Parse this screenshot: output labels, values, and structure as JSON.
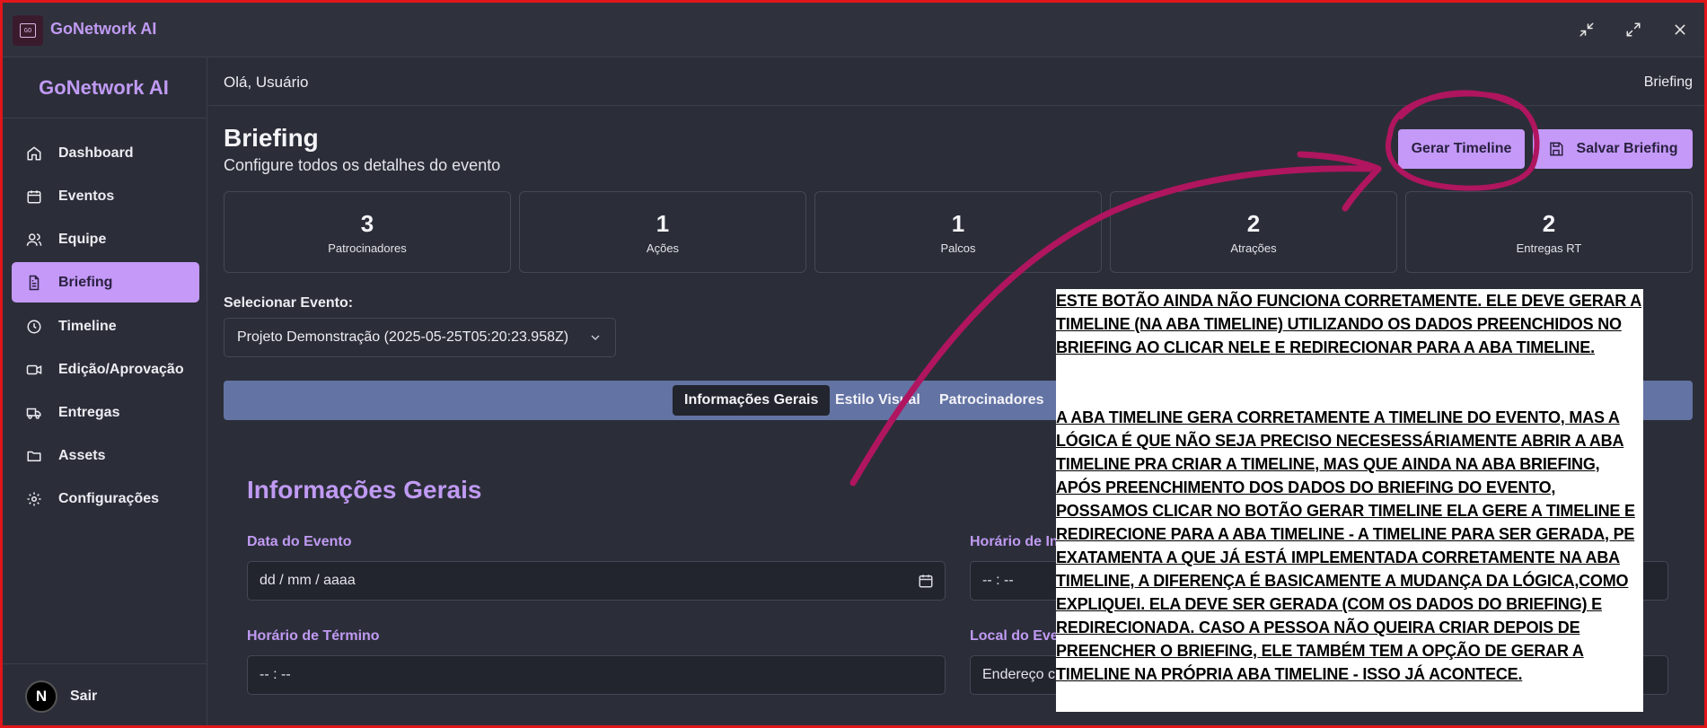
{
  "window": {
    "title": "GoNetwork AI",
    "logo_text": "GO"
  },
  "sidebar": {
    "brand": "GoNetwork AI",
    "items": [
      {
        "label": "Dashboard",
        "icon": "home-icon"
      },
      {
        "label": "Eventos",
        "icon": "calendar-icon"
      },
      {
        "label": "Equipe",
        "icon": "users-icon"
      },
      {
        "label": "Briefing",
        "icon": "file-text-icon",
        "active": true
      },
      {
        "label": "Timeline",
        "icon": "clock-icon"
      },
      {
        "label": "Edição/Aprovação",
        "icon": "video-icon"
      },
      {
        "label": "Entregas",
        "icon": "truck-icon"
      },
      {
        "label": "Assets",
        "icon": "folder-icon"
      },
      {
        "label": "Configurações",
        "icon": "gear-icon"
      }
    ],
    "avatar_letter": "N",
    "logout_label": "Sair"
  },
  "header": {
    "greeting": "Olá, Usuário",
    "breadcrumb": "Briefing"
  },
  "page": {
    "title": "Briefing",
    "subtitle": "Configure todos os detalhes do evento",
    "generate_button": "Gerar Timeline",
    "save_button": "Salvar Briefing"
  },
  "stats": [
    {
      "value": "3",
      "label": "Patrocinadores"
    },
    {
      "value": "1",
      "label": "Ações"
    },
    {
      "value": "1",
      "label": "Palcos"
    },
    {
      "value": "2",
      "label": "Atrações"
    },
    {
      "value": "2",
      "label": "Entregas RT"
    }
  ],
  "event_select": {
    "label": "Selecionar Evento:",
    "value": "Projeto Demonstração (2025-05-25T05:20:23.958Z)"
  },
  "tabs": [
    {
      "label": "Informações Gerais",
      "active": true
    },
    {
      "label": "Estilo Visual"
    },
    {
      "label": "Patrocinadores"
    }
  ],
  "section": {
    "title": "Informações Gerais",
    "event_date_label": "Data do Evento",
    "event_date_placeholder": "dd / mm / aaaa",
    "start_time_label": "Horário de In",
    "start_time_placeholder": "-- : --",
    "end_time_label": "Horário de Término",
    "end_time_placeholder": "-- : --",
    "location_label": "Local do Eve",
    "location_placeholder": "Endereço c"
  },
  "annotation": {
    "paragraph_1": "ESTE BOTÃO AINDA NÃO FUNCIONA CORRETAMENTE. ELE DEVE GERAR A TIMELINE (NA ABA TIMELINE) UTILIZANDO OS DADOS PREENCHIDOS NO BRIEFING AO CLICAR NELE E REDIRECIONAR PARA A ABA TIMELINE.",
    "paragraph_2": "A ABA TIMELINE GERA CORRETAMENTE A TIMELINE DO EVENTO, MAS A LÓGICA É QUE NÃO SEJA PRECISO NECESESSÁRIAMENTE ABRIR A ABA TIMELINE PRA CRIAR A TIMELINE, MAS QUE AINDA NA ABA BRIEFING, APÓS PREENCHIMENTO DOS DADOS DO BRIEFING DO EVENTO, POSSAMOS CLICAR NO BOTÃO GERAR TIMELINE ELA GERE A TIMELINE E REDIRECIONE PARA A ABA TIMELINE - A TIMELINE PARA SER GERADA, PE EXATAMENTA A QUE JÁ ESTÁ IMPLEMENTADA CORRETAMENTE NA ABA TIMELINE, A DIFERENÇA É BASICAMENTE A MUDANÇA DA LÓGICA,COMO EXPLIQUEI. ELA DEVE SER GERADA (COM OS DADOS DO BRIEFING) E REDIRECIONADA. CASO A PESSOA NÃO QUEIRA CRIAR DEPOIS DE PREENCHER O BRIEFING, ELE TAMBÉM TEM A OPÇÃO DE GERAR A TIMELINE NA PRÓPRIA ABA TIMELINE - ISSO JÁ ACONTECE.",
    "ink_color": "#b0155f"
  },
  "colors": {
    "accent": "#c499f8",
    "accent_text": "#c09af3",
    "tab_bar": "#6373a4",
    "frame": "#e0161b"
  }
}
